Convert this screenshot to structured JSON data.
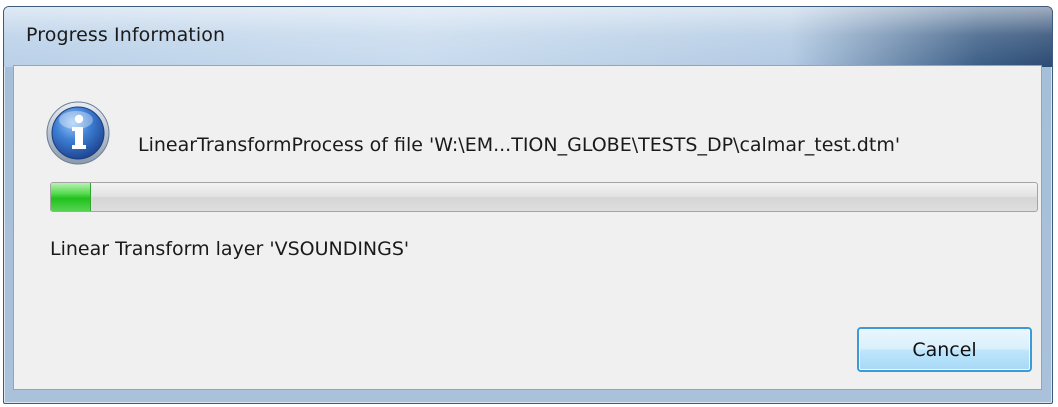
{
  "window": {
    "title": "Progress Information"
  },
  "dialog": {
    "icon": "info-icon",
    "message": "LinearTransformProcess of file 'W:\\EM...TION_GLOBE\\TESTS_DP\\calmar_test.dtm'",
    "progress_fraction": 0.04,
    "status": "Linear Transform layer 'VSOUNDINGS'",
    "cancel_label": "Cancel"
  },
  "colors": {
    "progress_fill": "#2cc426",
    "button_border": "#3c9ad6"
  }
}
